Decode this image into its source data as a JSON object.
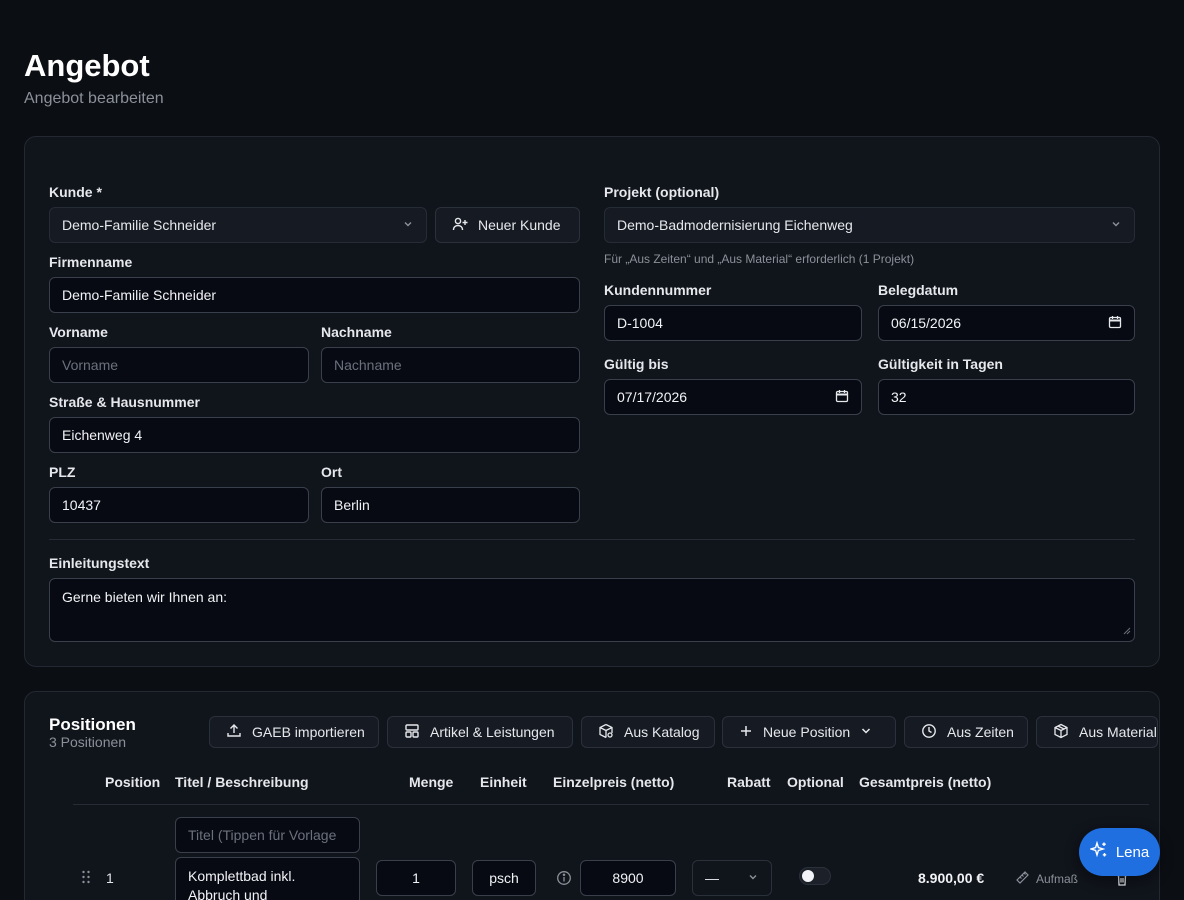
{
  "page": {
    "title": "Angebot",
    "subtitle": "Angebot bearbeiten"
  },
  "customer": {
    "label": "Kunde *",
    "selected": "Demo-Familie Schneider",
    "new_button": "Neuer Kunde",
    "company_label": "Firmenname",
    "company_value": "Demo-Familie Schneider",
    "firstname_label": "Vorname",
    "firstname_placeholder": "Vorname",
    "lastname_label": "Nachname",
    "lastname_placeholder": "Nachname",
    "street_label": "Straße & Hausnummer",
    "street_value": "Eichenweg 4",
    "zip_label": "PLZ",
    "zip_value": "10437",
    "city_label": "Ort",
    "city_value": "Berlin"
  },
  "project": {
    "label": "Projekt (optional)",
    "selected": "Demo-Badmodernisierung Eichenweg",
    "hint": "Für „Aus Zeiten“ und „Aus Material“ erforderlich (1 Projekt)",
    "customer_no_label": "Kundennummer",
    "customer_no_value": "D-1004",
    "doc_date_label": "Belegdatum",
    "doc_date_value": "06/15/2026",
    "valid_until_label": "Gültig bis",
    "valid_until_value": "07/17/2026",
    "validity_days_label": "Gültigkeit in Tagen",
    "validity_days_value": "32"
  },
  "intro": {
    "label": "Einleitungstext",
    "value": "Gerne bieten wir Ihnen an:"
  },
  "positions": {
    "title": "Positionen",
    "count": "3 Positionen",
    "toolbar": {
      "gaeb": "GAEB importieren",
      "articles": "Artikel & Leistungen",
      "catalog": "Aus Katalog",
      "new_position": "Neue Position",
      "from_times": "Aus Zeiten",
      "from_material": "Aus Material"
    },
    "columns": {
      "position": "Position",
      "title": "Titel / Beschreibung",
      "quantity": "Menge",
      "unit": "Einheit",
      "unit_price": "Einzelpreis (netto)",
      "discount": "Rabatt",
      "optional": "Optional",
      "total": "Gesamtpreis (netto)"
    },
    "rows": [
      {
        "number": "1",
        "title_placeholder": "Titel (Tippen für Vorlage",
        "description": "Komplettbad inkl. Abbruch und",
        "quantity": "1",
        "unit": "psch",
        "unit_price": "8900",
        "discount": "—",
        "total": "8.900,00 €",
        "measure_label": "Aufmaß"
      }
    ]
  },
  "assistant": {
    "label": "Lena"
  },
  "colors": {
    "background": "#0b0e13",
    "card": "#10141b",
    "accent": "#1f6fe0"
  }
}
